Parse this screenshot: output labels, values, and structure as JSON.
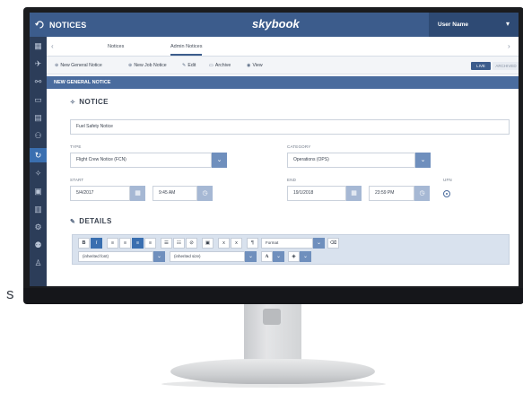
{
  "edge_text": "s",
  "topbar": {
    "back_icon": "back-arrow-icon",
    "title": "NOTICES",
    "logo": "skybook",
    "user_name": "User Name",
    "chevron": "▾"
  },
  "sidebar": {
    "icons": [
      "grid-icon",
      "plane-icon",
      "crew-icon",
      "chat-icon",
      "calendar-icon",
      "people-icon",
      "notices-icon",
      "pin-icon",
      "document-icon",
      "file-icon",
      "settings-icon",
      "users-icon",
      "user-icon"
    ],
    "active_index": 6
  },
  "tabs": {
    "left_arrow": "‹",
    "right_arrow": "›",
    "items": [
      {
        "label": "Notices"
      },
      {
        "label": "Admin Notices"
      }
    ]
  },
  "actions": {
    "new_general": "New General Notice",
    "new_job": "New Job Notice",
    "edit": "Edit",
    "archive": "Archive",
    "view": "View",
    "live": "LIVE",
    "archived": "ARCHIVED"
  },
  "section_header": "NEW GENERAL NOTICE",
  "notice": {
    "title": "NOTICE",
    "subject_value": "Fuel Safety Notice",
    "type_label": "TYPE",
    "type_value": "Flight Crew Notice (FCN)",
    "category_label": "CATEGORY",
    "category_value": "Operations (OPS)",
    "start_label": "START",
    "start_date": "5/4/2017",
    "start_time": "9:45 AM",
    "end_label": "END",
    "end_date": "19/1/2018",
    "end_time": "23:59 PM",
    "ufn_label": "UFN"
  },
  "details": {
    "title": "DETAILS",
    "format_label": "Format",
    "font_value": "(inherited font)",
    "size_value": "(inherited size)",
    "text_color_glyph": "A"
  },
  "colors": {
    "topbar": "#3c5c8c",
    "sidebar": "#2c3d59",
    "accent": "#3a6fb0",
    "section_header": "#4a6c9e"
  }
}
